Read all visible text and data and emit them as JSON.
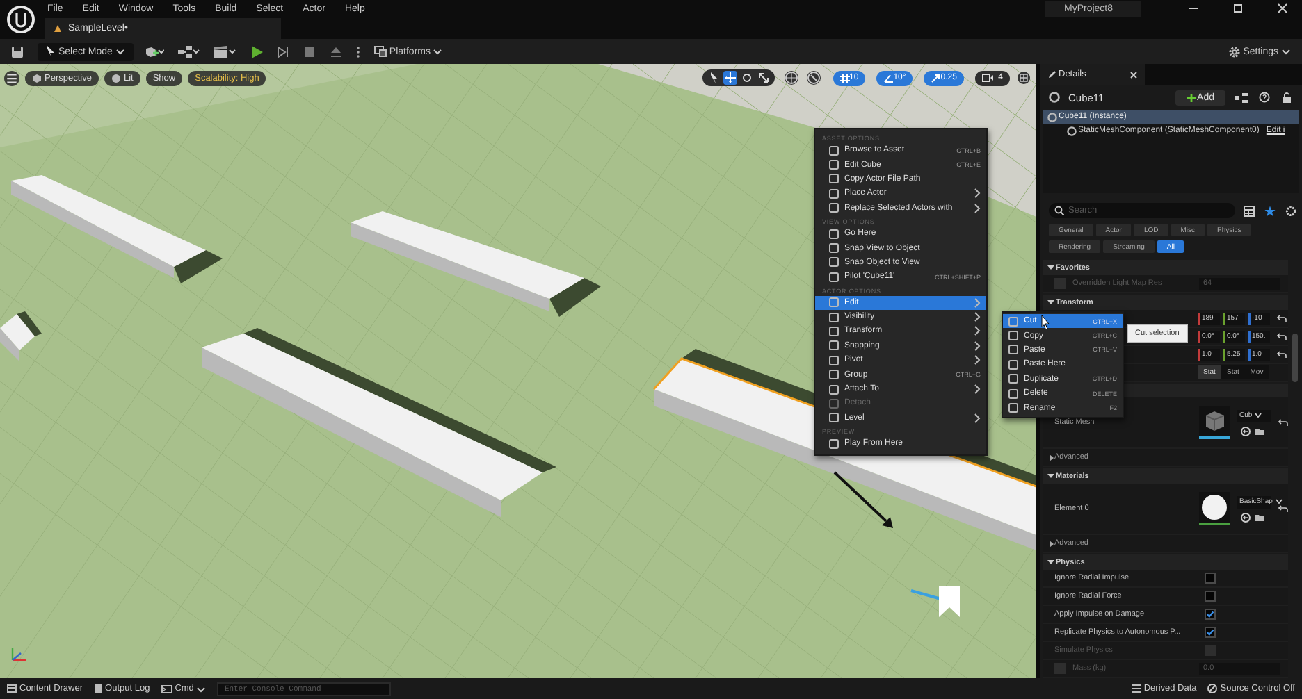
{
  "menu_bar": {
    "items": [
      "File",
      "Edit",
      "Window",
      "Tools",
      "Build",
      "Select",
      "Actor",
      "Help"
    ],
    "project": "MyProject8"
  },
  "level_tab": {
    "title": "SampleLevel•"
  },
  "toolbar": {
    "mode": "Select Mode",
    "platforms": "Platforms",
    "settings": "Settings"
  },
  "viewport_toolbar": {
    "view": "Perspective",
    "lighting": "Lit",
    "show": "Show",
    "scalability": "Scalability: High",
    "grid_snap": "10",
    "rotation_snap": "10°",
    "scale_snap": "0.25",
    "camera_speed": "4"
  },
  "context_menu": {
    "sections": [
      {
        "header": "ASSET OPTIONS",
        "items": [
          {
            "label": "Browse to Asset",
            "shortcut": "CTRL+B",
            "submenu": false,
            "disabled": false,
            "selected": false
          },
          {
            "label": "Edit Cube",
            "shortcut": "CTRL+E",
            "submenu": false,
            "disabled": false,
            "selected": false
          },
          {
            "label": "Copy Actor File Path",
            "submenu": false,
            "disabled": false,
            "selected": false
          },
          {
            "label": "Place Actor",
            "submenu": true,
            "disabled": false,
            "selected": false
          },
          {
            "label": "Replace Selected Actors with",
            "submenu": true,
            "disabled": false,
            "selected": false
          }
        ]
      },
      {
        "header": "VIEW OPTIONS",
        "items": [
          {
            "label": "Go Here",
            "submenu": false,
            "disabled": false,
            "selected": false
          },
          {
            "label": "Snap View to Object",
            "submenu": false,
            "disabled": false,
            "selected": false
          },
          {
            "label": "Snap Object to View",
            "submenu": false,
            "disabled": false,
            "selected": false
          },
          {
            "label": "Pilot 'Cube11'",
            "shortcut": "CTRL+SHIFT+P",
            "submenu": false,
            "disabled": false,
            "selected": false
          }
        ]
      },
      {
        "header": "ACTOR OPTIONS",
        "items": [
          {
            "label": "Edit",
            "submenu": true,
            "disabled": false,
            "selected": true
          },
          {
            "label": "Visibility",
            "submenu": true,
            "disabled": false,
            "selected": false
          },
          {
            "label": "Transform",
            "submenu": true,
            "disabled": false,
            "selected": false
          },
          {
            "label": "Snapping",
            "submenu": true,
            "disabled": false,
            "selected": false
          },
          {
            "label": "Pivot",
            "submenu": true,
            "disabled": false,
            "selected": false
          },
          {
            "label": "Group",
            "shortcut": "CTRL+G",
            "submenu": false,
            "disabled": false,
            "selected": false
          },
          {
            "label": "Attach To",
            "submenu": true,
            "disabled": false,
            "selected": false
          },
          {
            "label": "Detach",
            "submenu": false,
            "disabled": true,
            "selected": false
          },
          {
            "label": "Level",
            "submenu": true,
            "disabled": false,
            "selected": false
          }
        ]
      },
      {
        "header": "PREVIEW",
        "items": [
          {
            "label": "Play From Here",
            "submenu": false,
            "disabled": false,
            "selected": false
          }
        ]
      }
    ]
  },
  "submenu": {
    "items": [
      {
        "label": "Cut",
        "shortcut": "CTRL+X",
        "selected": true
      },
      {
        "label": "Copy",
        "shortcut": "CTRL+C",
        "selected": false
      },
      {
        "label": "Paste",
        "shortcut": "CTRL+V",
        "selected": false
      },
      {
        "label": "Paste Here",
        "selected": false
      },
      {
        "label": "Duplicate",
        "shortcut": "CTRL+D",
        "selected": false
      },
      {
        "label": "Delete",
        "shortcut": "DELETE",
        "selected": false
      },
      {
        "label": "Rename",
        "shortcut": "F2",
        "selected": false
      }
    ]
  },
  "tooltip": "Cut selection",
  "details": {
    "tab": "Details",
    "actor": "Cube11",
    "add": "Add",
    "tree": [
      {
        "label": "Cube11 (Instance)",
        "selected": true,
        "children": [
          {
            "label": "StaticMeshComponent (StaticMeshComponent0)",
            "link": "Edit i",
            "selected": false
          }
        ]
      }
    ],
    "search_placeholder": "Search",
    "filters": [
      {
        "label": "General",
        "selected": false
      },
      {
        "label": "Actor",
        "selected": false
      },
      {
        "label": "LOD",
        "selected": false
      },
      {
        "label": "Misc",
        "selected": false
      },
      {
        "label": "Physics",
        "selected": false
      },
      {
        "label": "Rendering",
        "selected": false
      },
      {
        "label": "Streaming",
        "selected": false
      },
      {
        "label": "All",
        "selected": true
      }
    ],
    "sections": [
      {
        "title": "Favorites",
        "expanded": true,
        "rows": [
          {
            "kind": "check_value",
            "label": "Overridden Light Map Res",
            "checked": false,
            "disabled": true,
            "value": "64"
          }
        ]
      },
      {
        "title": "Transform",
        "expanded": true,
        "rows": [
          {
            "kind": "vector",
            "values": [
              "189",
              "157",
              "-10"
            ]
          },
          {
            "kind": "vector",
            "values": [
              "0.0°",
              "0.0°",
              "150."
            ]
          },
          {
            "kind": "vector",
            "values": [
              "1.0",
              "5.25",
              "1.0"
            ]
          },
          {
            "kind": "segmented",
            "options": [
              {
                "label": "Stat",
                "selected": true
              },
              {
                "label": "Stat",
                "selected": false
              },
              {
                "label": "Mov",
                "selected": false
              }
            ]
          }
        ]
      },
      {
        "rows": [
          {
            "kind": "asset",
            "label": "Static Mesh",
            "asset": "Cub",
            "thumbnail": {
              "kind": "cube"
            }
          },
          {
            "kind": "group",
            "label": "Advanced",
            "expanded": false
          }
        ]
      },
      {
        "title": "Materials",
        "expanded": true,
        "rows": [
          {
            "kind": "asset",
            "label": "Element 0",
            "asset": "BasicShap",
            "thumbnail": {
              "kind": "sphere"
            }
          },
          {
            "kind": "group",
            "label": "Advanced",
            "expanded": false
          }
        ]
      },
      {
        "title": "Physics",
        "expanded": true,
        "rows": [
          {
            "kind": "check",
            "label": "Ignore Radial Impulse",
            "checked": false,
            "disabled": false
          },
          {
            "kind": "check",
            "label": "Ignore Radial Force",
            "checked": false,
            "disabled": false
          },
          {
            "kind": "check",
            "label": "Apply Impulse on Damage",
            "checked": true,
            "disabled": false
          },
          {
            "kind": "check",
            "label": "Replicate Physics to Autonomous P...",
            "checked": true,
            "disabled": false
          },
          {
            "kind": "check",
            "label": "Simulate Physics",
            "checked": false,
            "disabled": true
          },
          {
            "kind": "check_value",
            "label": "Mass (kg)",
            "checked": false,
            "disabled": true,
            "value": "0.0"
          }
        ]
      }
    ]
  },
  "status_bar": {
    "content_drawer": "Content Drawer",
    "output_log": "Output Log",
    "cmd": "Cmd",
    "console_placeholder": "Enter Console Command",
    "derived_data": "Derived Data",
    "source_control": "Source Control Off"
  }
}
